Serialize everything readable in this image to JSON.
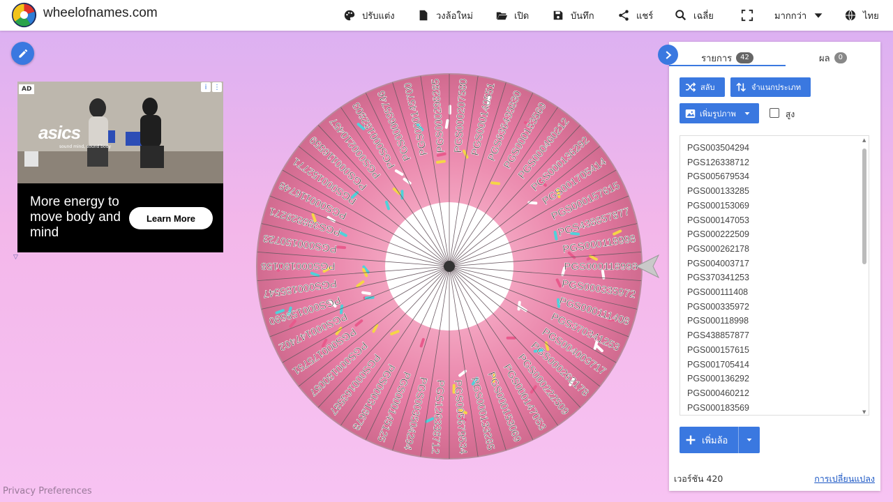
{
  "app": {
    "site_title": "wheelofnames.com"
  },
  "nav": {
    "items": [
      {
        "label": "ปรับแต่ง",
        "icon": "palette-icon"
      },
      {
        "label": "วงล้อใหม่",
        "icon": "file-icon"
      },
      {
        "label": "เปิด",
        "icon": "folder-open-icon"
      },
      {
        "label": "บันทึก",
        "icon": "save-icon"
      },
      {
        "label": "แชร์",
        "icon": "share-icon"
      },
      {
        "label": "เฉลี่ย",
        "icon": "search-icon"
      },
      {
        "label": "",
        "icon": "fullscreen-icon"
      },
      {
        "label": "มากกว่า",
        "icon": "caret-down-icon"
      },
      {
        "label": "ไทย",
        "icon": "globe-icon"
      }
    ]
  },
  "ad": {
    "badge": "AD",
    "brand": "asics",
    "tagline": "sound mind, sound body",
    "headline": "More energy to move body and mind",
    "cta": "Learn More"
  },
  "panel": {
    "tab_entries_label": "รายการ",
    "tab_entries_count": "42",
    "tab_results_label": "ผล",
    "tab_results_count": "0",
    "shuffle_label": "สลับ",
    "sort_label": "จำแนกประเภท",
    "add_image_label": "เพิ่มรูปภาพ",
    "advanced_label": "สูง",
    "entries": [
      "PGS003504294",
      "PGS126338712",
      "PGS005679534",
      "PGS000133285",
      "PGS000153069",
      "PGS000147053",
      "PGS000222509",
      "PGS000262178",
      "PGS004003717",
      "PGS370341253",
      "PGS000111408",
      "PGS000335972",
      "PGS000118998",
      "PGS438857877",
      "PGS000157615",
      "PGS001705414",
      "PGS000136292",
      "PGS000460212",
      "PGS000183569"
    ],
    "add_wheel_label": "เพิ่มล้อ",
    "version": "เวอร์ชัน 420",
    "changelog": "การเปลี่ยนแปลง"
  },
  "wheel": {
    "segments": [
      "PGS000118998",
      "PGS000335972",
      "PGS000111408",
      "PGS370341253",
      "PGS004003717",
      "PGS000262178",
      "PGS000222509",
      "PGS000147053",
      "PGS000153069",
      "PGS000133285",
      "PGS005679534",
      "PGS126338712",
      "PGS003504294",
      "PGS000145125",
      "PGS000318678",
      "PGS000163587",
      "PGS000180057",
      "PGS000175751",
      "PGS000147402",
      "PGS000159690",
      "PGS000185547",
      "PGS000180158",
      "PGS000150723",
      "PGS388829271",
      "PGS000116748",
      "PGS000152771",
      "PGS000116559",
      "PGS000210457",
      "PGS000182803",
      "PGS000635746",
      "PGS000145700",
      "PGS000298285",
      "PGS000207580",
      "PGS000140551",
      "PGS636435830",
      "PGS000183569",
      "PGS000460212",
      "PGS000136292",
      "PGS001705414",
      "PGS000157615",
      "PGS438857877",
      "PGS000118998"
    ],
    "colors": {
      "donut": "#e97fa6",
      "sprinkle_a": "#4fd1d9",
      "sprinkle_b": "#f5d547",
      "sprinkle_c": "#ffffff"
    }
  },
  "footer": {
    "privacy": "Privacy Preferences"
  }
}
